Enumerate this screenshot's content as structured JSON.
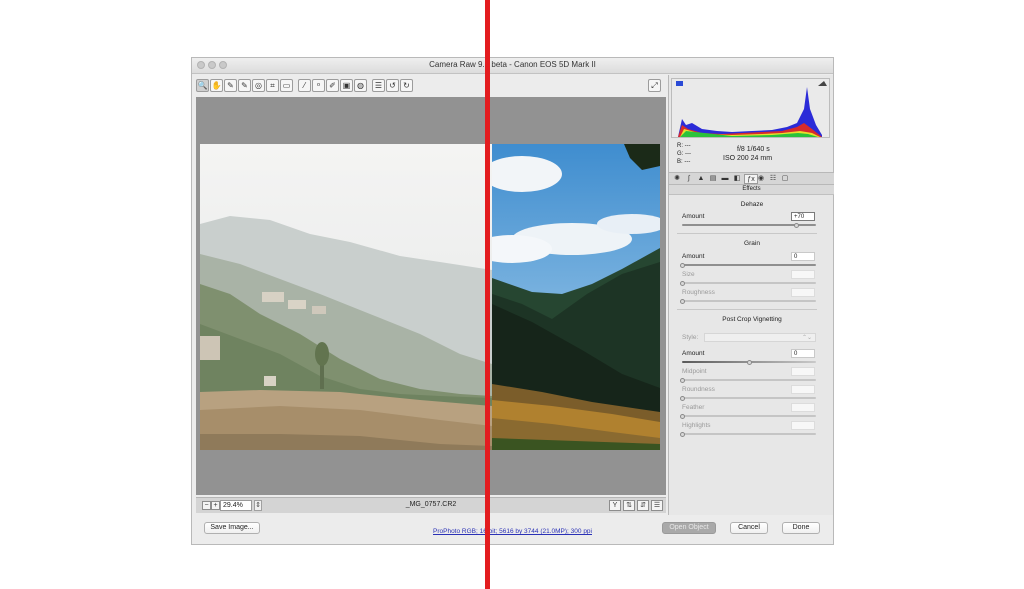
{
  "window": {
    "title": "Camera Raw 9.1 beta  -  Canon EOS 5D Mark II"
  },
  "toolbar": {
    "tools": [
      {
        "icon": "zoom-icon",
        "glyph": "🔍",
        "selected": true
      },
      {
        "icon": "hand-icon",
        "glyph": "✋"
      },
      {
        "icon": "eyedropper-icon",
        "glyph": "✎"
      },
      {
        "icon": "color-sampler-icon",
        "glyph": "✎"
      },
      {
        "icon": "target-adjust-icon",
        "glyph": "◎"
      },
      {
        "icon": "crop-icon",
        "glyph": "⌗"
      },
      {
        "icon": "straighten-icon",
        "glyph": "▭"
      },
      {
        "icon": "spot-removal-icon",
        "glyph": "⁄"
      },
      {
        "icon": "red-eye-icon",
        "glyph": "ᵒ"
      },
      {
        "icon": "adjustment-brush-icon",
        "glyph": "✐"
      },
      {
        "icon": "graduated-filter-icon",
        "glyph": "▣"
      },
      {
        "icon": "radial-filter-icon",
        "glyph": "◍"
      },
      {
        "icon": "preferences-icon",
        "glyph": "☰"
      },
      {
        "icon": "rotate-ccw-icon",
        "glyph": "↺"
      },
      {
        "icon": "rotate-cw-icon",
        "glyph": "↻"
      }
    ],
    "preview_icon": "full-screen-icon"
  },
  "status": {
    "zoom": "29.4%",
    "filename": "_MG_0757.CR2"
  },
  "histogram": {
    "shadow_clip_icon": "shadow-clipping-icon",
    "highlight_clip_icon": "highlight-clipping-icon"
  },
  "readout": {
    "r": "R:  ---",
    "g": "G:  ---",
    "b": "B:  ---",
    "exposure": "f/8    1/640 s",
    "iso": "ISO 200    24 mm"
  },
  "panel": {
    "header": "Effects",
    "dehaze": {
      "title": "Dehaze",
      "amount_label": "Amount",
      "amount_value": "+70",
      "amount_level": 0.85
    },
    "grain": {
      "title": "Grain",
      "amount_label": "Amount",
      "amount_value": "0",
      "size_label": "Size",
      "roughness_label": "Roughness"
    },
    "vignette": {
      "title": "Post Crop Vignetting",
      "style_label": "Style:",
      "amount_label": "Amount",
      "amount_value": "0",
      "midpoint_label": "Midpoint",
      "roundness_label": "Roundness",
      "feather_label": "Feather",
      "highlights_label": "Highlights"
    }
  },
  "footer": {
    "save_label": "Save Image...",
    "workflow": "ProPhoto RGB; 16 bit; 5616 by 3744 (21.0MP); 300 ppi",
    "open_label": "Open Object",
    "cancel_label": "Cancel",
    "done_label": "Done"
  },
  "colors": {
    "divider": "#e31c1f",
    "link": "#2a31b6"
  }
}
